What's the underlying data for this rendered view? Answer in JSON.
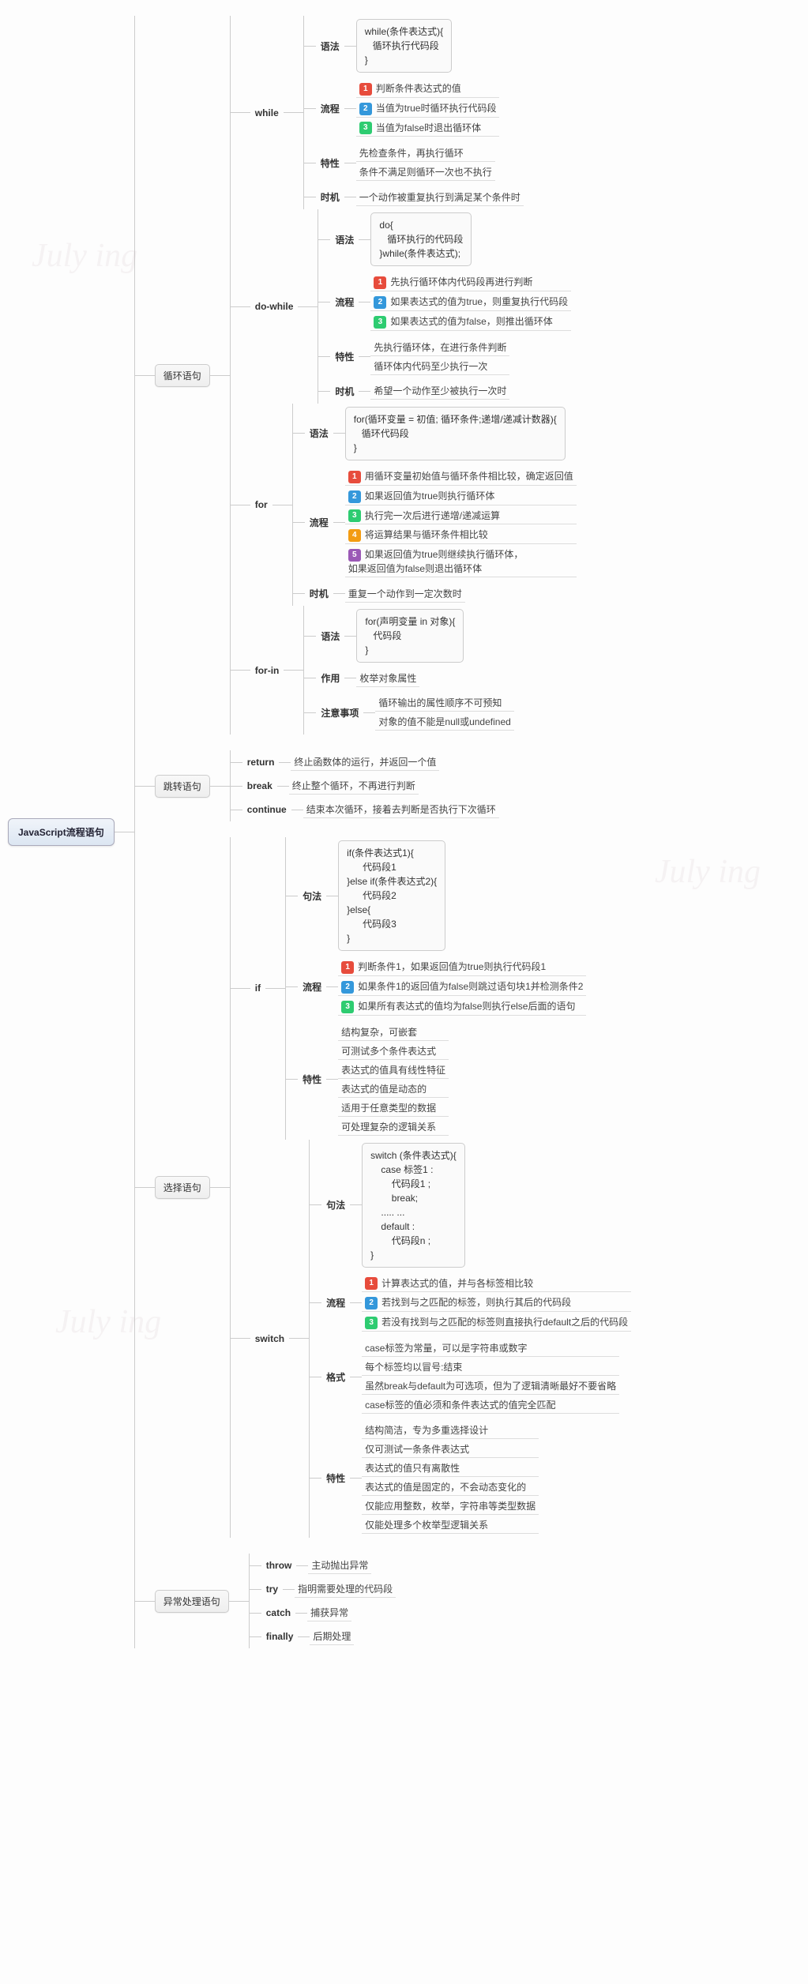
{
  "root": "JavaScript流程语句",
  "watermark": "July ing",
  "loop": {
    "title": "循环语句",
    "while": {
      "title": "while",
      "syntax_label": "语法",
      "syntax_code": "while(条件表达式){\n   循环执行代码段\n}",
      "flow_label": "流程",
      "flow": [
        "判断条件表达式的值",
        "当值为true时循环执行代码段",
        "当值为false时退出循环体"
      ],
      "trait_label": "特性",
      "trait": [
        "先检查条件，再执行循环",
        "条件不满足则循环一次也不执行"
      ],
      "timing_label": "时机",
      "timing": "一个动作被重复执行到满足某个条件时"
    },
    "dowhile": {
      "title": "do-while",
      "syntax_label": "语法",
      "syntax_code": "do{\n   循环执行的代码段\n}while(条件表达式);",
      "flow_label": "流程",
      "flow": [
        "先执行循环体内代码段再进行判断",
        "如果表达式的值为true，则重复执行代码段",
        "如果表达式的值为false，则推出循环体"
      ],
      "trait_label": "特性",
      "trait": [
        "先执行循环体，在进行条件判断",
        "循环体内代码至少执行一次"
      ],
      "timing_label": "时机",
      "timing": "希望一个动作至少被执行一次时"
    },
    "for": {
      "title": "for",
      "syntax_label": "语法",
      "syntax_code": "for(循环变量 = 初值; 循环条件;递增/递减计数器){\n   循环代码段\n}",
      "flow_label": "流程",
      "flow": [
        "用循环变量初始值与循环条件相比较，确定返回值",
        "如果返回值为true则执行循环体",
        "执行完一次后进行递增/递减运算",
        "将运算结果与循环条件相比较",
        "如果返回值为true则继续执行循环体，\n如果返回值为false则退出循环体"
      ],
      "timing_label": "时机",
      "timing": "重复一个动作到一定次数时"
    },
    "forin": {
      "title": "for-in",
      "syntax_label": "语法",
      "syntax_code": "for(声明变量 in 对象){\n   代码段\n}",
      "role_label": "作用",
      "role": "枚举对象属性",
      "notes_label": "注意事项",
      "notes": [
        "循环输出的属性顺序不可预知",
        "对象的值不能是null或undefined"
      ]
    }
  },
  "jump": {
    "title": "跳转语句",
    "return": {
      "title": "return",
      "desc": "终止函数体的运行，并返回一个值"
    },
    "break": {
      "title": "break",
      "desc": "终止整个循环，不再进行判断"
    },
    "continue": {
      "title": "continue",
      "desc": "结束本次循环，接着去判断是否执行下次循环"
    }
  },
  "select": {
    "title": "选择语句",
    "if": {
      "title": "if",
      "syntax_label": "句法",
      "syntax_code": "if(条件表达式1){\n      代码段1\n}else if(条件表达式2){\n      代码段2\n}else{\n      代码段3\n}",
      "flow_label": "流程",
      "flow": [
        "判断条件1，如果返回值为true则执行代码段1",
        "如果条件1的返回值为false则跳过语句块1并检测条件2",
        "如果所有表达式的值均为false则执行else后面的语句"
      ],
      "trait_label": "特性",
      "trait": [
        "结构复杂，可嵌套",
        "可测试多个条件表达式",
        "表达式的值具有线性特征",
        "表达式的值是动态的",
        "适用于任意类型的数据",
        "可处理复杂的逻辑关系"
      ]
    },
    "switch": {
      "title": "switch",
      "syntax_label": "句法",
      "syntax_code": "switch (条件表达式){\n    case 标签1 :\n        代码段1 ;\n        break;\n    ..... ...\n    default :\n        代码段n ;\n}",
      "flow_label": "流程",
      "flow": [
        "计算表达式的值，并与各标签相比较",
        "若找到与之匹配的标签，则执行其后的代码段",
        "若没有找到与之匹配的标签则直接执行default之后的代码段"
      ],
      "format_label": "格式",
      "format": [
        "case标签为常量，可以是字符串或数字",
        "每个标签均以冒号:结束",
        "虽然break与default为可选项，但为了逻辑清晰最好不要省略",
        "case标签的值必须和条件表达式的值完全匹配"
      ],
      "trait_label": "特性",
      "trait": [
        "结构简洁，专为多重选择设计",
        "仅可测试一条条件表达式",
        "表达式的值只有离散性",
        "表达式的值是固定的，不会动态变化的",
        "仅能应用整数，枚举，字符串等类型数据",
        "仅能处理多个枚举型逻辑关系"
      ]
    }
  },
  "exception": {
    "title": "异常处理语句",
    "throw": {
      "title": "throw",
      "desc": "主动抛出异常"
    },
    "try": {
      "title": "try",
      "desc": "指明需要处理的代码段"
    },
    "catch": {
      "title": "catch",
      "desc": "捕获异常"
    },
    "finally": {
      "title": "finally",
      "desc": "后期处理"
    }
  }
}
